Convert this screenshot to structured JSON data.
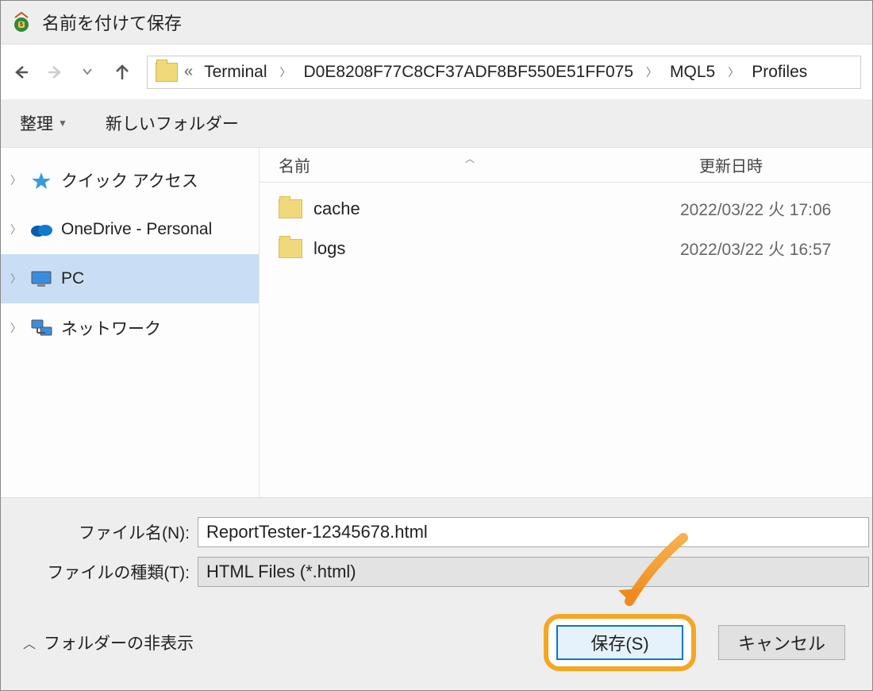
{
  "title": "名前を付けて保存",
  "breadcrumb": {
    "overflow_indicator": "«",
    "segments": [
      "Terminal",
      "D0E8208F77C8CF37ADF8BF550E51FF075",
      "MQL5",
      "Profiles"
    ]
  },
  "toolbar": {
    "organize": "整理",
    "new_folder": "新しいフォルダー"
  },
  "tree": {
    "items": [
      {
        "label": "クイック アクセス",
        "icon": "quick-access",
        "selected": false
      },
      {
        "label": "OneDrive - Personal",
        "icon": "onedrive",
        "selected": false
      },
      {
        "label": "PC",
        "icon": "pc",
        "selected": true
      },
      {
        "label": "ネットワーク",
        "icon": "network",
        "selected": false
      }
    ]
  },
  "columns": {
    "name": "名前",
    "date": "更新日時"
  },
  "rows": [
    {
      "name": "cache",
      "date": "2022/03/22 火 17:06"
    },
    {
      "name": "logs",
      "date": "2022/03/22 火 16:57"
    }
  ],
  "form": {
    "filename_label": "ファイル名(N):",
    "filename_value": "ReportTester-12345678.html",
    "filetype_label": "ファイルの種類(T):",
    "filetype_value": "HTML Files (*.html)"
  },
  "actions": {
    "hide_folders": "フォルダーの非表示",
    "save": "保存(S)",
    "cancel": "キャンセル"
  }
}
